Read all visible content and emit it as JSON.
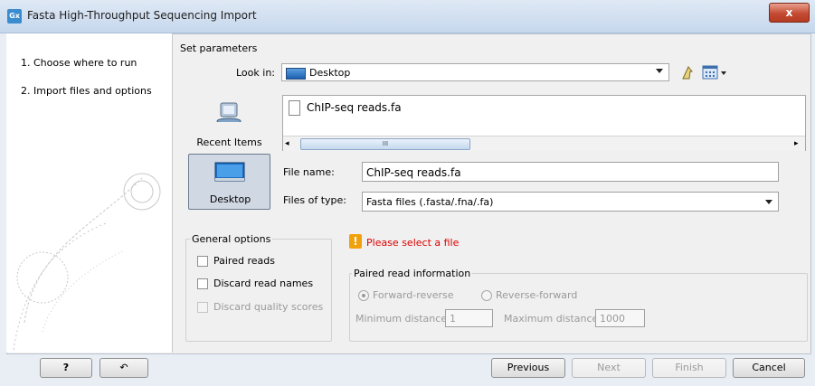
{
  "window": {
    "title": "Fasta High-Throughput Sequencing Import",
    "app_icon": "Gx",
    "close_label": "x"
  },
  "steps": [
    {
      "label": "1.  Choose where to run"
    },
    {
      "label": "2.  Import files and options"
    }
  ],
  "params": {
    "section_title": "Set parameters",
    "look_in_label": "Look in:",
    "look_in_value": "Desktop",
    "nav": {
      "recent_label": "Recent Items",
      "desktop_label": "Desktop"
    },
    "files": [
      {
        "name": "ChIP-seq reads.fa"
      }
    ],
    "scroll_grip": "III",
    "file_name_label": "File name:",
    "file_name_value": "ChIP-seq reads.fa",
    "file_type_label": "Files of type:",
    "file_type_value": "Fasta files (.fasta/.fna/.fa)"
  },
  "general_options": {
    "title": "General options",
    "paired_reads": "Paired reads",
    "discard_read_names": "Discard read names",
    "discard_quality_scores": "Discard quality scores"
  },
  "warning": {
    "text": "Please select a file",
    "icon": "!"
  },
  "paired_info": {
    "title": "Paired read information",
    "forward_reverse": "Forward-reverse",
    "reverse_forward": "Reverse-forward",
    "min_distance_label": "Minimum distance",
    "min_distance_value": "1",
    "max_distance_label": "Maximum distance",
    "max_distance_value": "1000"
  },
  "footer": {
    "help": "?",
    "reset_icon": "↶",
    "previous": "Previous",
    "next": "Next",
    "finish": "Finish",
    "cancel": "Cancel"
  }
}
